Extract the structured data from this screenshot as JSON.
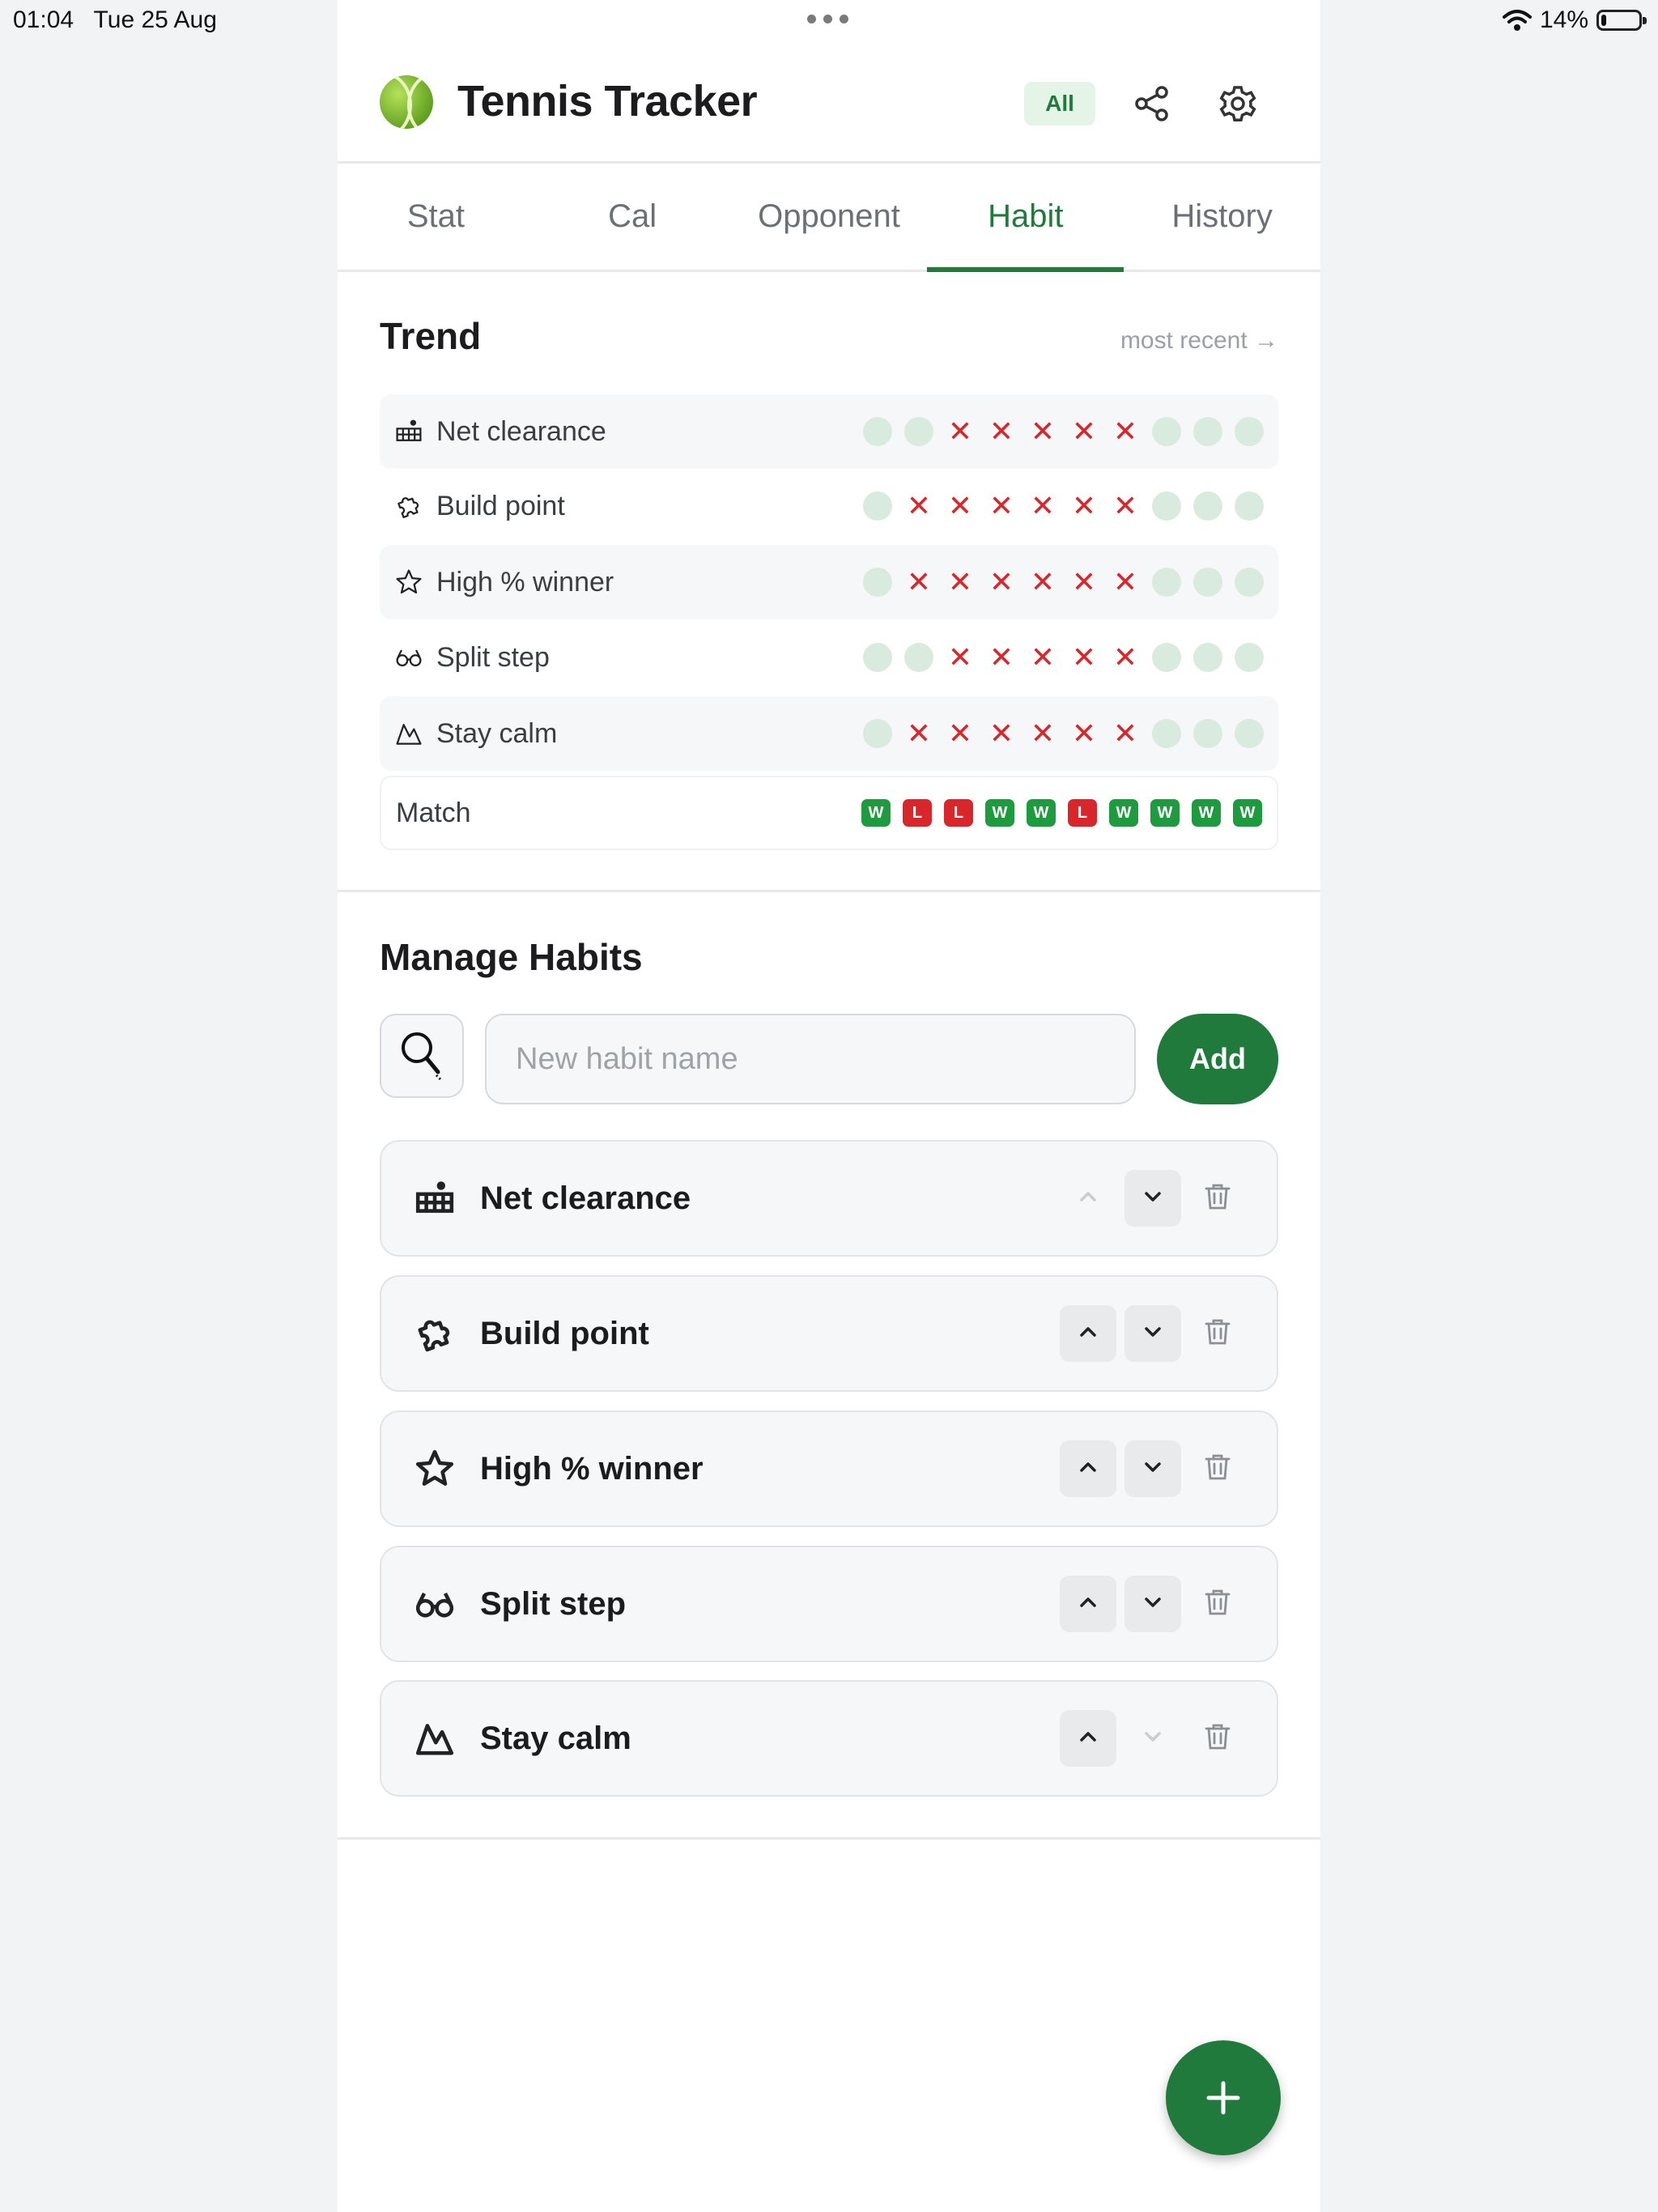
{
  "status_bar": {
    "time": "01:04",
    "date": "Tue 25 Aug",
    "battery": "14%",
    "battery_level": 0.14
  },
  "header": {
    "title": "Tennis Tracker",
    "filter_chip": "All",
    "icons": [
      "tennis-ball-icon",
      "share-icon",
      "gear-icon"
    ]
  },
  "tabs": [
    {
      "label": "Stat",
      "active": false
    },
    {
      "label": "Cal",
      "active": false
    },
    {
      "label": "Opponent",
      "active": false
    },
    {
      "label": "Habit",
      "active": true
    },
    {
      "label": "History",
      "active": false
    }
  ],
  "trend": {
    "title": "Trend",
    "order_hint": "most recent →",
    "legend": {
      "ok": "light-green-dot",
      "miss": "red-x"
    },
    "rows": [
      {
        "label": "Net clearance",
        "icon": "net-icon",
        "marks": [
          "ok",
          "ok",
          "x",
          "x",
          "x",
          "x",
          "x",
          "ok",
          "ok",
          "ok"
        ]
      },
      {
        "label": "Build point",
        "icon": "puzzle-icon",
        "marks": [
          "ok",
          "x",
          "x",
          "x",
          "x",
          "x",
          "x",
          "ok",
          "ok",
          "ok"
        ]
      },
      {
        "label": "High % winner",
        "icon": "star-icon",
        "marks": [
          "ok",
          "x",
          "x",
          "x",
          "x",
          "x",
          "x",
          "ok",
          "ok",
          "ok"
        ]
      },
      {
        "label": "Split step",
        "icon": "glasses-icon",
        "marks": [
          "ok",
          "ok",
          "x",
          "x",
          "x",
          "x",
          "x",
          "ok",
          "ok",
          "ok"
        ]
      },
      {
        "label": "Stay calm",
        "icon": "mountain-icon",
        "marks": [
          "ok",
          "x",
          "x",
          "x",
          "x",
          "x",
          "x",
          "ok",
          "ok",
          "ok"
        ]
      }
    ],
    "match": {
      "label": "Match",
      "results": [
        "W",
        "L",
        "L",
        "W",
        "W",
        "L",
        "W",
        "W",
        "W",
        "W"
      ]
    }
  },
  "manage": {
    "title": "Manage Habits",
    "input_placeholder": "New habit name",
    "input_value": "",
    "add_label": "Add",
    "habits": [
      {
        "name": "Net clearance",
        "icon": "net-icon",
        "can_move_up": false,
        "can_move_down": true
      },
      {
        "name": "Build point",
        "icon": "puzzle-icon",
        "can_move_up": true,
        "can_move_down": true
      },
      {
        "name": "High % winner",
        "icon": "star-icon",
        "can_move_up": true,
        "can_move_down": true
      },
      {
        "name": "Split step",
        "icon": "glasses-icon",
        "can_move_up": true,
        "can_move_down": true
      },
      {
        "name": "Stay calm",
        "icon": "mountain-icon",
        "can_move_up": true,
        "can_move_down": false
      }
    ]
  },
  "colors": {
    "accent": "#1f7a3b",
    "win": "#1e9b3e",
    "loss": "#d9262a",
    "ok_dot": "#d8ebde"
  }
}
